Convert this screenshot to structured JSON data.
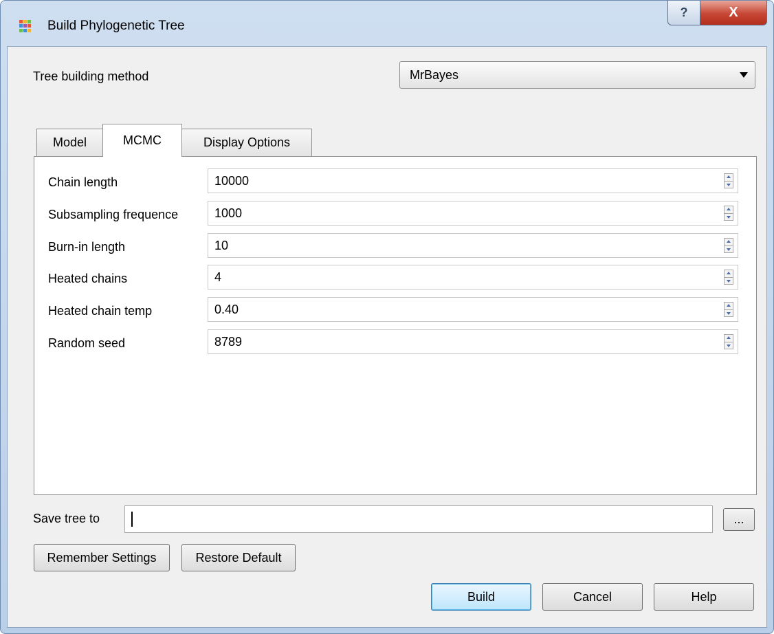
{
  "window": {
    "title": "Build Phylogenetic Tree",
    "help_glyph": "?",
    "close_glyph": "X",
    "icon": "grid-app-icon"
  },
  "method": {
    "label": "Tree building method",
    "selected": "MrBayes"
  },
  "tabs": [
    {
      "label": "Model",
      "active": false
    },
    {
      "label": "MCMC",
      "active": true
    },
    {
      "label": "Display Options",
      "active": false
    }
  ],
  "mcmc": {
    "rows": [
      {
        "label": "Chain length",
        "value": "10000"
      },
      {
        "label": "Subsampling frequence",
        "value": "1000"
      },
      {
        "label": "Burn-in length",
        "value": "10"
      },
      {
        "label": "Heated chains",
        "value": "4"
      },
      {
        "label": "Heated chain temp",
        "value": "0.40"
      },
      {
        "label": "Random seed",
        "value": "8789"
      }
    ]
  },
  "save": {
    "label": "Save tree to",
    "value": "",
    "browse_label": "..."
  },
  "buttons": {
    "remember": "Remember Settings",
    "restore": "Restore Default",
    "build": "Build",
    "cancel": "Cancel",
    "help": "Help"
  },
  "colors": {
    "accent": "#3c7fb1",
    "close": "#c74634",
    "title_gradient": "#cfdff1"
  }
}
